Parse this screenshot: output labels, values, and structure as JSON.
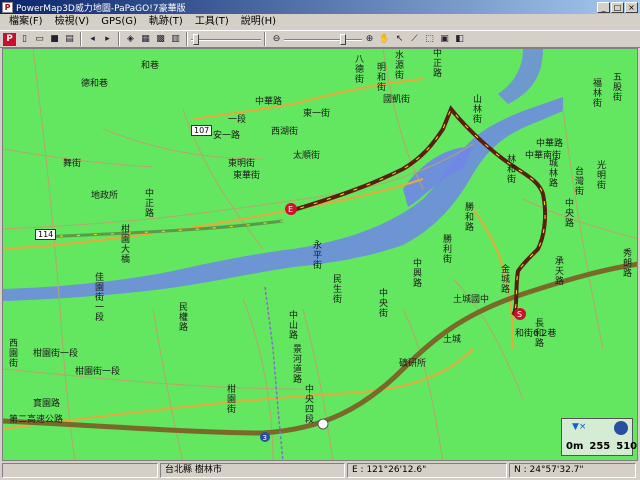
{
  "window": {
    "title": "PowerMap3D威力地圖-PaPaGO!7豪華版"
  },
  "menu": [
    "檔案(F)",
    "檢視(V)",
    "GPS(G)",
    "軌跡(T)",
    "工具(T)",
    "說明(H)"
  ],
  "map": {
    "route_markers": {
      "end": "E",
      "start": "S"
    },
    "highway_shields": [
      "107",
      "114"
    ],
    "freeway_shield": "3",
    "labels_h": [
      {
        "id": "he-xiang",
        "t": "和巷"
      },
      {
        "id": "de-he-xiang",
        "t": "德和巷"
      },
      {
        "id": "zhong-hua-lu",
        "t": "中華路"
      },
      {
        "id": "yi-duan",
        "t": "一段"
      },
      {
        "id": "an-yi-lu",
        "t": "安一路"
      },
      {
        "id": "dong-ming-jie",
        "t": "東明街"
      },
      {
        "id": "tai-ding-jie",
        "t": "太順街"
      },
      {
        "id": "dong-hua-jie",
        "t": "東華街"
      },
      {
        "id": "di-zheng-suo",
        "t": "地政所"
      },
      {
        "id": "zhong-shan-lu-r",
        "t": "中華路"
      },
      {
        "id": "zhong-hua-nan-r",
        "t": "中華南街"
      },
      {
        "id": "xi-hu-jie",
        "t": "西湖街"
      },
      {
        "id": "dong-yi-jie",
        "t": "東一街"
      },
      {
        "id": "guo-fan-jie",
        "t": "國凱街"
      },
      {
        "id": "tu-cheng-guo-zhong",
        "t": "土城國中"
      },
      {
        "id": "tu-cheng",
        "t": "土城"
      },
      {
        "id": "cheng-he-xiang",
        "t": "和街6.2巷"
      },
      {
        "id": "kuang-yan-suo",
        "t": "礦研所"
      },
      {
        "id": "gan-yuan",
        "t": "柑園街一段"
      },
      {
        "id": "di-er-gao",
        "t": "第二高速公路"
      },
      {
        "id": "bao-yuan",
        "t": "寶園路"
      },
      {
        "id": "gan-yuan-jie",
        "t": "柑園街一段"
      },
      {
        "id": "wu-jie",
        "t": "舞街"
      }
    ],
    "labels_v": [
      {
        "id": "ba-de-jie",
        "t": "八德街"
      },
      {
        "id": "shui-yuan-jie",
        "t": "水源街"
      },
      {
        "id": "ming-he-jie",
        "t": "明和街"
      },
      {
        "id": "zhong-zheng-lu",
        "t": "中正路"
      },
      {
        "id": "cheng-lin-lu",
        "t": "城林路"
      },
      {
        "id": "lin-he-jie",
        "t": "林和街"
      },
      {
        "id": "zhong-yang-lu",
        "t": "中央路"
      },
      {
        "id": "guang-ming-jie",
        "t": "光明街"
      },
      {
        "id": "fu-lin-jie",
        "t": "福林街"
      },
      {
        "id": "tai-an-jie",
        "t": "台灣街"
      },
      {
        "id": "gan-yuan-da-qiao",
        "t": "柑園大橋"
      },
      {
        "id": "jia-yuan-jie",
        "t": "佳園街一段"
      },
      {
        "id": "min-quan-lu",
        "t": "民權路"
      },
      {
        "id": "zhong-shan-lu",
        "t": "中山路"
      },
      {
        "id": "jing-he-dao-lu",
        "t": "景河道路"
      },
      {
        "id": "zhong-yang-4",
        "t": "中央四段"
      },
      {
        "id": "yun-xing-lu",
        "t": "中興路"
      },
      {
        "id": "cheng-tian-lu",
        "t": "承天路"
      },
      {
        "id": "jin-ping-lu",
        "t": "金城路"
      },
      {
        "id": "gan-yuan-jie-v",
        "t": "柑園街"
      },
      {
        "id": "ti-he-lu",
        "t": "勝和路"
      },
      {
        "id": "min-sheng-jie",
        "t": "民生街"
      },
      {
        "id": "xi-yuan-jie",
        "t": "西園街"
      },
      {
        "id": "zhong-hua-v",
        "t": "中正路"
      },
      {
        "id": "ba-he",
        "t": "長和路"
      },
      {
        "id": "wu-gu-jie",
        "t": "五股街"
      },
      {
        "id": "shan-lin",
        "t": "山林街"
      },
      {
        "id": "zhong-yang-jie",
        "t": "中央街"
      },
      {
        "id": "yong-ping-jie",
        "t": "永平街"
      },
      {
        "id": "sheng-li-jie",
        "t": "勝利街"
      },
      {
        "id": "xiu-lang",
        "t": "秀朗路"
      }
    ]
  },
  "status": {
    "area": "台北縣 樹林市",
    "east": "E : 121°26'12.6\"",
    "north": "N : 24°57'32.7\""
  },
  "scale": {
    "zero": "0m",
    "mid": "255",
    "max": "510"
  },
  "colors": {
    "map_bg": "#63e660",
    "river": "#6f86e8",
    "route": "#5a1e0c",
    "route_arrow": "#f5e400",
    "freeway": "#7a6a2a"
  }
}
